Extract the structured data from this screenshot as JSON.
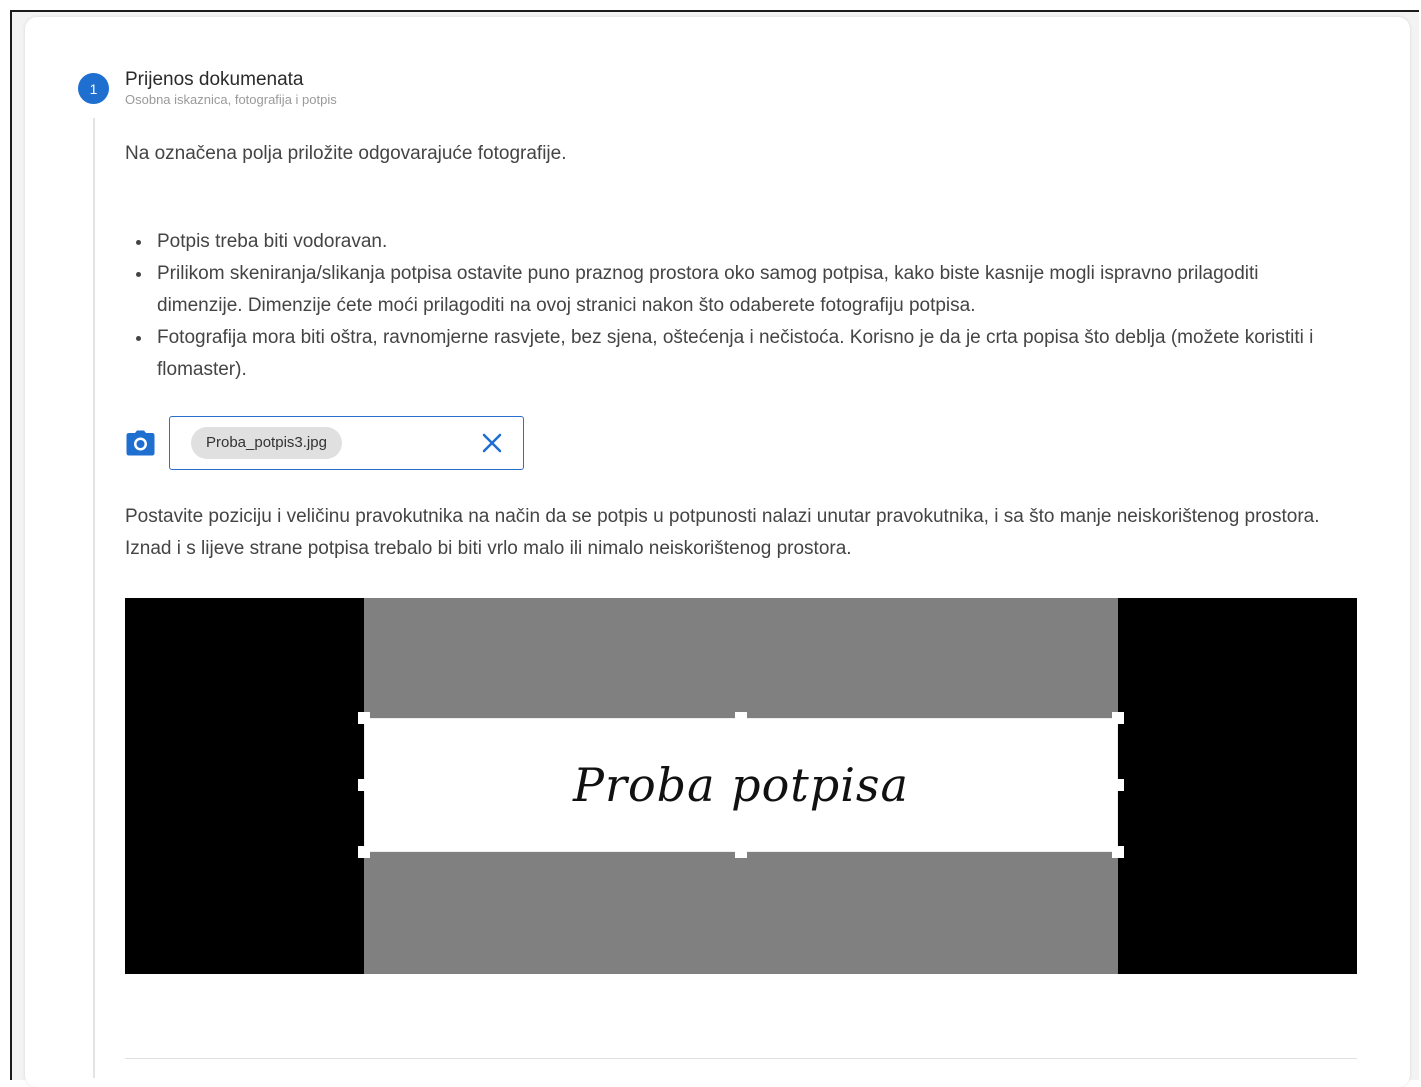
{
  "step": {
    "number": "1",
    "title": "Prijenos dokumenata",
    "subtitle": "Osobna iskaznica, fotografija i potpis"
  },
  "intro_text": "Na označena polja priložite odgovarajuće fotografije.",
  "rules": [
    "Potpis treba biti vodoravan.",
    "Prilikom skeniranja/slikanja potpisa ostavite puno praznog prostora oko samog potpisa, kako biste kasnije mogli ispravno prilagoditi dimenzije. Dimenzije ćete moći prilagoditi na ovoj stranici nakon što odaberete fotografiju potpisa.",
    "Fotografija mora biti oštra, ravnomjerne rasvjete, bez sjena, oštećenja i nečistoća. Korisno je da je crta popisa što deblja (možete koristiti i flomaster)."
  ],
  "upload": {
    "icon": "camera-icon",
    "file_name": "Proba_potpis3.jpg",
    "clear_icon": "close-icon"
  },
  "crop_instructions": "Postavite poziciju i veličinu pravokutnika na način da se potpis u potpunosti nalazi unutar pravokutnika, i sa što manje neiskorištenog prostora. Iznad i s lijeve strane potpisa trebalo bi biti vrlo malo ili nimalo neiskorištenog prostora.",
  "signature_preview": {
    "text": "Proba potpisa"
  },
  "colors": {
    "accent": "#1e6fd0",
    "cropper_background": "#000000",
    "image_background": "#808080"
  }
}
